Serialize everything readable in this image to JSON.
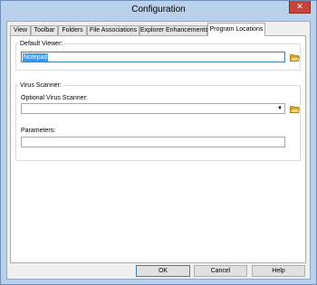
{
  "window": {
    "title": "Configuration",
    "close_symbol": "✕"
  },
  "tabs": [
    {
      "label": "View"
    },
    {
      "label": "Toolbar"
    },
    {
      "label": "Folders"
    },
    {
      "label": "File Associations"
    },
    {
      "label": "Explorer Enhancements"
    },
    {
      "label": "Program Locations",
      "active": true
    }
  ],
  "default_viewer": {
    "group_label": "Default Viewer:",
    "value": "Notepad",
    "browse_icon": "open-folder-icon"
  },
  "virus_scanner": {
    "group_label": "Virus Scanner:",
    "optional_label": "Optional Virus Scanner:",
    "value": "",
    "dropdown_arrow": "▼",
    "browse_icon": "open-folder-icon",
    "parameters_label": "Parameters:",
    "parameters_value": ""
  },
  "buttons": {
    "ok": "OK",
    "cancel": "Cancel",
    "help": "Help"
  },
  "colors": {
    "title_bar": "#b9d1ea",
    "close_button": "#c7443a",
    "selection": "#3399ff",
    "folder": "#e8b830"
  }
}
